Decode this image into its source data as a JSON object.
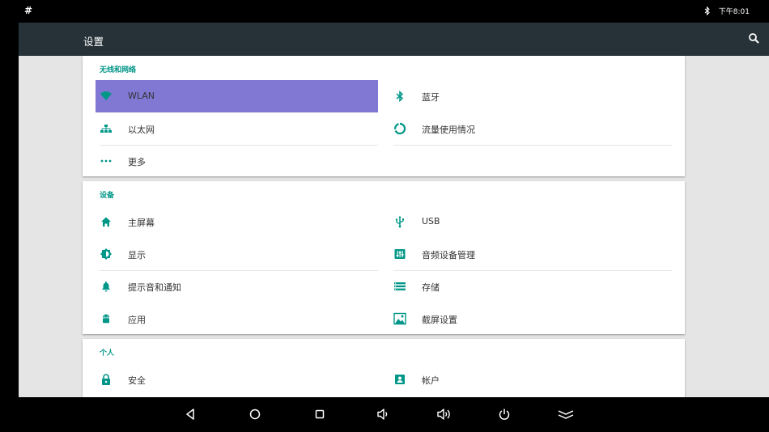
{
  "status_bar": {
    "left_symbol": "#",
    "time": "下午8:01",
    "bluetooth_icon": "bluetooth-icon"
  },
  "app_bar": {
    "title": "设置",
    "search_icon": "search-icon"
  },
  "categories": [
    {
      "title": "无线和网络",
      "tiles": [
        {
          "label": "WLAN",
          "icon": "wifi-icon",
          "selected": true
        },
        {
          "label": "蓝牙",
          "icon": "bluetooth-icon"
        },
        {
          "label": "以太网",
          "icon": "ethernet-icon"
        },
        {
          "label": "流量使用情况",
          "icon": "data-usage-icon"
        },
        {
          "label": "更多",
          "icon": "more-dots-icon"
        }
      ]
    },
    {
      "title": "设备",
      "tiles": [
        {
          "label": "主屏幕",
          "icon": "home-icon"
        },
        {
          "label": "USB",
          "icon": "usb-icon"
        },
        {
          "label": "显示",
          "icon": "brightness-icon"
        },
        {
          "label": "音频设备管理",
          "icon": "audio-equalizer-icon"
        },
        {
          "label": "提示音和通知",
          "icon": "bell-icon"
        },
        {
          "label": "存储",
          "icon": "storage-icon"
        },
        {
          "label": "应用",
          "icon": "android-icon"
        },
        {
          "label": "截屏设置",
          "icon": "screenshot-image-icon"
        }
      ]
    },
    {
      "title": "个人",
      "tiles": [
        {
          "label": "安全",
          "icon": "lock-icon"
        },
        {
          "label": "帐户",
          "icon": "account-icon"
        }
      ]
    }
  ],
  "nav_bar": [
    "back-icon",
    "home-circle-icon",
    "recents-icon",
    "volume-down-icon",
    "volume-up-icon",
    "power-icon",
    "hide-bar-icon"
  ],
  "colors": {
    "accent": "#009688",
    "selected_tile": "#8178d4",
    "app_bar": "#263238",
    "background": "#e5e5e5"
  }
}
